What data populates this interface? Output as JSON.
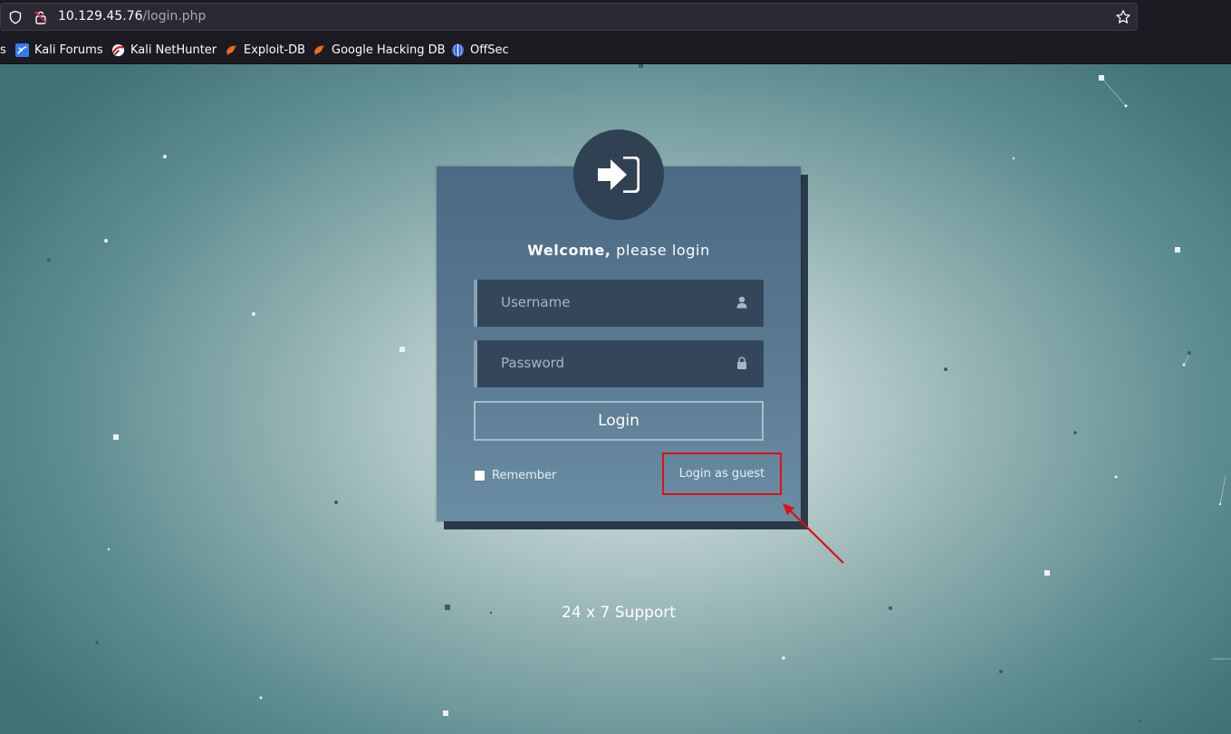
{
  "browser": {
    "url_host": "10.129.45.76",
    "url_path": "/login.php",
    "bookmarks": [
      {
        "label": "s",
        "icon": "truncated-bookmark"
      },
      {
        "label": "Kali Forums",
        "icon": "kali-forums-icon"
      },
      {
        "label": "Kali NetHunter",
        "icon": "kali-nethunter-icon"
      },
      {
        "label": "Exploit-DB",
        "icon": "exploit-db-icon"
      },
      {
        "label": "Google Hacking DB",
        "icon": "google-hacking-db-icon"
      },
      {
        "label": "OffSec",
        "icon": "offsec-icon"
      }
    ]
  },
  "login": {
    "welcome_bold": "Welcome,",
    "welcome_rest": " please login",
    "username_placeholder": "Username",
    "password_placeholder": "Password",
    "login_button": "Login",
    "remember_label": "Remember",
    "guest_link": "Login as guest",
    "annotation_color": "#e01010"
  },
  "footer": {
    "support_text": "24 x 7 Support"
  },
  "colors": {
    "card": "#5a7890",
    "field": "#34465a",
    "avatar": "#2f4152"
  }
}
